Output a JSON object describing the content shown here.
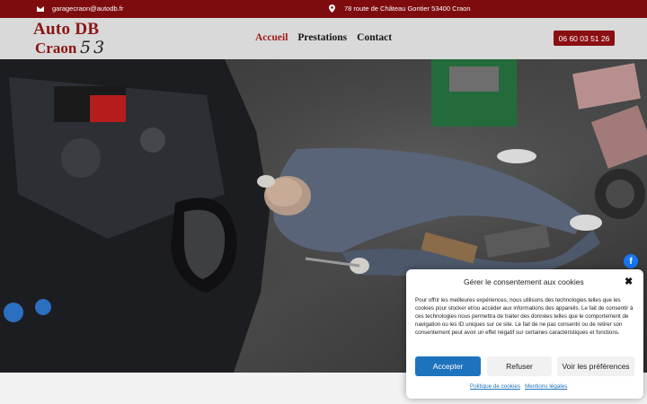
{
  "topbar": {
    "email": "garagecraon@autodb.fr",
    "address": "78 route de Château Gontier 53400 Craon"
  },
  "logo": {
    "line1": "Auto DB",
    "line2": "Craon",
    "line3": "53"
  },
  "nav": {
    "items": [
      "Accueil",
      "Prestations",
      "Contact"
    ],
    "active": "Accueil"
  },
  "header": {
    "phone": "06 60 03 51 26"
  },
  "social": {
    "facebook": "f"
  },
  "consent": {
    "title": "Gérer le consentement aux cookies",
    "close": "✖",
    "body": "Pour offrir les meilleures expériences, nous utilisons des technologies telles que les cookies pour stocker et/ou accéder aux informations des appareils. Le fait de consentir à ces technologies nous permettra de traiter des données telles que le comportement de navigation ou les ID uniques sur ce site. Le fait de ne pas consentir ou de retirer son consentement peut avoir un effet négatif sur certaines caractéristiques et fonctions.",
    "accept": "Accepter",
    "refuse": "Refuser",
    "preferences": "Voir les préférences",
    "link_cookies": "Politique de cookies",
    "link_legal": "Mentions légales"
  },
  "colors": {
    "brand": "#7e0c0f",
    "accent": "#1e73be",
    "header_bg": "#d9d9d9"
  }
}
